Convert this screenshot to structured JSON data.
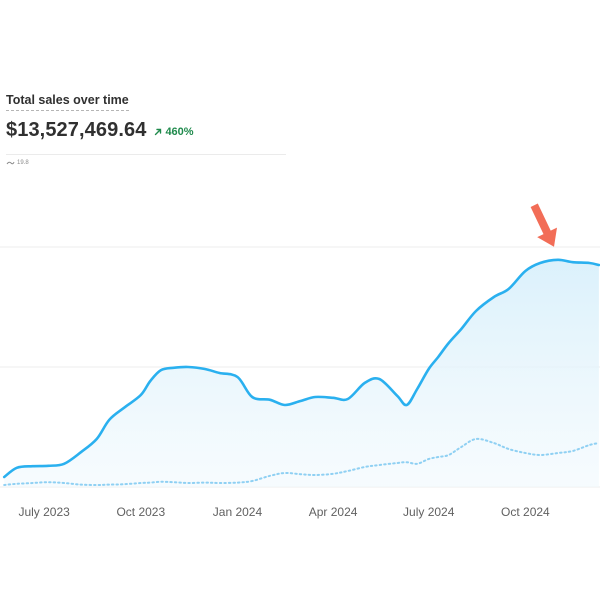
{
  "header": {
    "title": "Total sales over time",
    "metric": "$13,527,469.64",
    "change": "460%",
    "legend_label": "19.8"
  },
  "colors": {
    "primary": "#2ab0ef",
    "comparison": "#8fd0f3",
    "positive": "#1f8a4c",
    "annotation": "#f26d57"
  },
  "chart_data": {
    "type": "area",
    "title": "Total sales over time",
    "x_tick_labels": [
      "July 2023",
      "Oct 2023",
      "Jan 2024",
      "Apr 2024",
      "July 2024",
      "Oct 2024"
    ],
    "grid": true,
    "x": [
      "2023-05-24",
      "2023-06-05",
      "2023-06-20",
      "2023-07-05",
      "2023-07-20",
      "2023-08-05",
      "2023-08-20",
      "2023-09-01",
      "2023-09-15",
      "2023-10-01",
      "2023-10-10",
      "2023-10-20",
      "2023-11-01",
      "2023-11-15",
      "2023-12-01",
      "2023-12-15",
      "2024-01-01",
      "2024-01-15",
      "2024-02-01",
      "2024-02-15",
      "2024-03-01",
      "2024-03-15",
      "2024-04-01",
      "2024-04-15",
      "2024-05-01",
      "2024-05-15",
      "2024-06-01",
      "2024-06-10",
      "2024-06-20",
      "2024-07-01",
      "2024-07-10",
      "2024-07-20",
      "2024-08-01",
      "2024-08-15",
      "2024-09-01",
      "2024-09-15",
      "2024-10-01",
      "2024-10-15",
      "2024-11-01",
      "2024-11-15",
      "2024-12-01",
      "2024-12-10"
    ],
    "series": [
      {
        "style": "solid",
        "values": [
          0.25,
          0.48,
          0.52,
          0.53,
          0.58,
          0.87,
          1.2,
          1.68,
          1.98,
          2.3,
          2.65,
          2.92,
          2.98,
          3.0,
          2.95,
          2.85,
          2.75,
          2.25,
          2.18,
          2.05,
          2.15,
          2.25,
          2.23,
          2.2,
          2.6,
          2.7,
          2.28,
          2.05,
          2.45,
          2.95,
          3.25,
          3.6,
          3.95,
          4.4,
          4.75,
          4.95,
          5.4,
          5.6,
          5.68,
          5.62,
          5.6,
          5.55
        ]
      },
      {
        "style": "dotted",
        "values": [
          0.05,
          0.08,
          0.1,
          0.12,
          0.1,
          0.06,
          0.05,
          0.06,
          0.07,
          0.1,
          0.11,
          0.13,
          0.12,
          0.1,
          0.11,
          0.1,
          0.11,
          0.15,
          0.28,
          0.35,
          0.32,
          0.3,
          0.33,
          0.4,
          0.5,
          0.55,
          0.6,
          0.62,
          0.58,
          0.7,
          0.75,
          0.8,
          1.0,
          1.2,
          1.1,
          0.95,
          0.85,
          0.8,
          0.85,
          0.9,
          1.05,
          1.1
        ]
      }
    ],
    "annotation": "arrow pointing down at the peak near Nov 2024"
  }
}
